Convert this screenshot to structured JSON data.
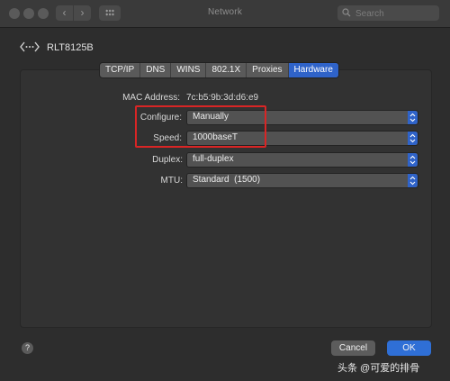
{
  "window": {
    "title": "Network",
    "search_placeholder": "Search"
  },
  "interface": {
    "name": "RLT8125B"
  },
  "tabs": [
    {
      "label": "TCP/IP",
      "active": false
    },
    {
      "label": "DNS",
      "active": false
    },
    {
      "label": "WINS",
      "active": false
    },
    {
      "label": "802.1X",
      "active": false
    },
    {
      "label": "Proxies",
      "active": false
    },
    {
      "label": "Hardware",
      "active": true
    }
  ],
  "hardware": {
    "mac_label": "MAC Address:",
    "mac_value": "7c:b5:9b:3d:d6:e9",
    "configure_label": "Configure:",
    "configure_value": "Manually",
    "speed_label": "Speed:",
    "speed_value": "1000baseT",
    "duplex_label": "Duplex:",
    "duplex_value": "full-duplex",
    "mtu_label": "MTU:",
    "mtu_value": "Standard  (1500)"
  },
  "buttons": {
    "help": "?",
    "cancel": "Cancel",
    "ok": "OK"
  },
  "watermark": "头条 @可爱的排骨",
  "colors": {
    "accent": "#2f63c9",
    "highlight_box": "#d92525",
    "window_bg": "#2d2d2d"
  }
}
